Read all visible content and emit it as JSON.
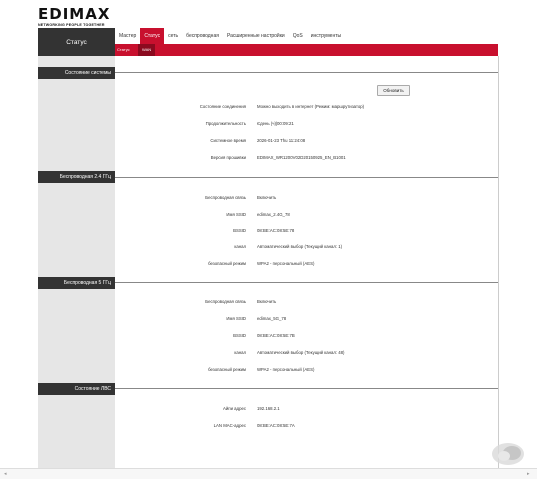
{
  "brand": {
    "name": "EDIMAX",
    "tagline": "NETWORKING PEOPLE TOGETHER"
  },
  "page_badge": "Статус",
  "tabs": [
    {
      "label": "Мастер",
      "active": false
    },
    {
      "label": "Статус",
      "active": true
    },
    {
      "label": "сеть",
      "active": false
    },
    {
      "label": "беспроводная",
      "active": false
    },
    {
      "label": "Расширенные настройки",
      "active": false
    },
    {
      "label": "QoS",
      "active": false
    },
    {
      "label": "инструменты",
      "active": false
    }
  ],
  "subtabs": [
    {
      "label": "Статус",
      "active": false
    },
    {
      "label": "WAN",
      "active": true
    }
  ],
  "sections": {
    "system": {
      "title": "Состояние системы",
      "refresh_label": "Обновить",
      "rows": [
        {
          "label": "Состояние соединения",
          "value": "Можно выходить в интернет (Режим: маршрутизатор)"
        },
        {
          "label": "Продолжительность",
          "value": "Єдень (ч)|00:09:21"
        },
        {
          "label": "Системное время",
          "value": "2026-01-23 Thu 11:24:08"
        },
        {
          "label": "Версия прошивки",
          "value": "EDIMAX_WR1200V02D20150925_EN_B1001"
        }
      ]
    },
    "wifi24": {
      "title": "Беспроводная 2.4 ГГц",
      "rows": [
        {
          "label": "Беспроводная связь",
          "value": "Включить"
        },
        {
          "label": "Имя SSID",
          "value": "edimax_2.4G_78"
        },
        {
          "label": "BSSID",
          "value": "08:BE:AC:08:5E:78"
        },
        {
          "label": "канал",
          "value": "Автоматический выбор (Текущий канал: 1)"
        },
        {
          "label": "безопасный режим",
          "value": "WPA2 - персональный (AES)"
        }
      ]
    },
    "wifi5": {
      "title": "Беспроводная 5 ГГц",
      "rows": [
        {
          "label": "Беспроводная связь",
          "value": "Включить"
        },
        {
          "label": "Имя SSID",
          "value": "edimax_5G_78"
        },
        {
          "label": "BSSID",
          "value": "08:BE:AC:08:5E:7B"
        },
        {
          "label": "канал",
          "value": "Автоматический выбор (Текущий канал: 48)"
        },
        {
          "label": "безопасный режим",
          "value": "WPA2 - персональный (AES)"
        }
      ]
    },
    "lan": {
      "title": "Состояние ЛВС",
      "rows": [
        {
          "label": "Айпи адрес",
          "value": "192.168.2.1"
        },
        {
          "label": "LAN MAC-адрес",
          "value": "08:BE:AC:08:5E:7A"
        }
      ]
    }
  },
  "colors": {
    "accent": "#c8102e",
    "dark": "#333333",
    "sidebar": "#e6e6e6"
  }
}
